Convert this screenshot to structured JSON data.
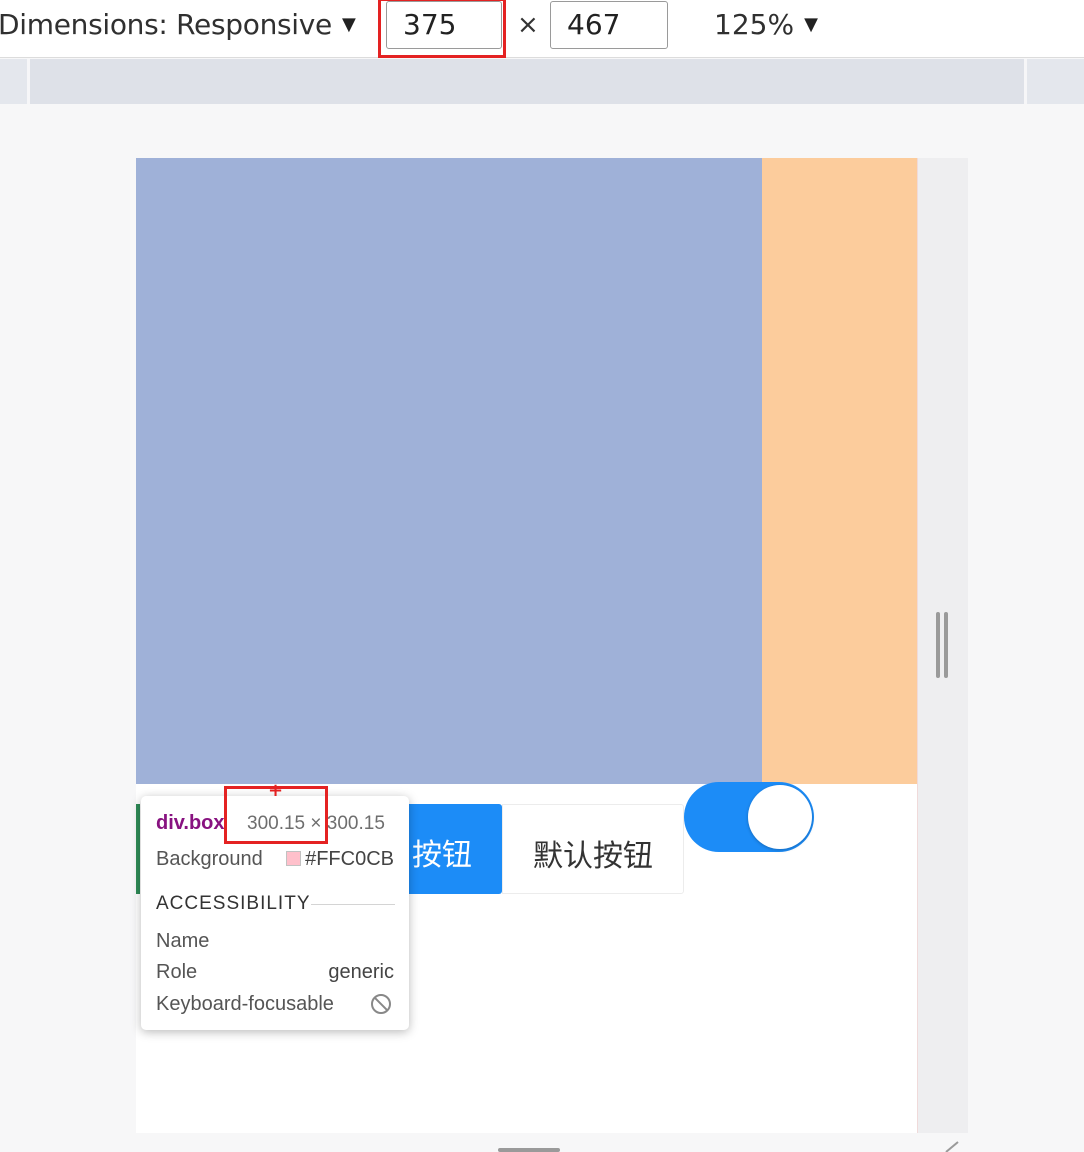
{
  "toolbar": {
    "dimensions_label": "Dimensions: Responsive",
    "width_value": "375",
    "times_symbol": "×",
    "height_value": "467",
    "zoom_label": "125%",
    "caret": "▼"
  },
  "page": {
    "primary_button_label": "按钮",
    "default_button_label": "默认按钮",
    "toggle_on": true,
    "colors": {
      "box_blue": "#9fb1d8",
      "box_orange": "#fccc9c",
      "primary": "#1c8cf7"
    }
  },
  "inspector_tooltip": {
    "selector": "div.box",
    "size": "300.15 × 300.15",
    "background_label": "Background",
    "background_value": "#FFC0CB",
    "accessibility_heading": "ACCESSIBILITY",
    "name_label": "Name",
    "role_label": "Role",
    "role_value": "generic",
    "keyboard_label": "Keyboard-focusable",
    "keyboard_icon": "not-allowed-icon"
  },
  "annotations": {
    "highlight_color": "#e42222"
  }
}
